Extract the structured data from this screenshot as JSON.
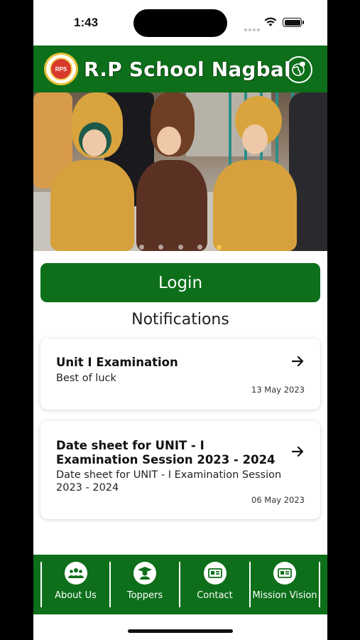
{
  "status_bar": {
    "time": "1:43"
  },
  "header": {
    "title": "R.P School Nagbal",
    "logo_text": "RPS",
    "logo_icon": "school-logo",
    "right_icon": "globe-location-icon",
    "color": "#0d6f1a"
  },
  "banner": {
    "slide_count": 5,
    "active_slide": 4
  },
  "login": {
    "label": "Login"
  },
  "notifications": {
    "title": "Notifications",
    "items": [
      {
        "title": "Unit I Examination",
        "body": "Best of luck",
        "date": "13 May 2023"
      },
      {
        "title": "Date sheet for UNIT - I Examination Session 2023 - 2024",
        "body": "Date sheet for UNIT - I Examination Session 2023 - 2024",
        "date": "06 May 2023"
      }
    ]
  },
  "bottom_nav": {
    "items": [
      {
        "label": "About Us",
        "icon": "group-icon"
      },
      {
        "label": "Toppers",
        "icon": "graduate-icon"
      },
      {
        "label": "Contact",
        "icon": "contact-card-icon"
      },
      {
        "label": "Mission Vision",
        "icon": "vision-board-icon"
      }
    ]
  },
  "colors": {
    "primary": "#0d6f1a",
    "accent": "#f2c94c"
  }
}
